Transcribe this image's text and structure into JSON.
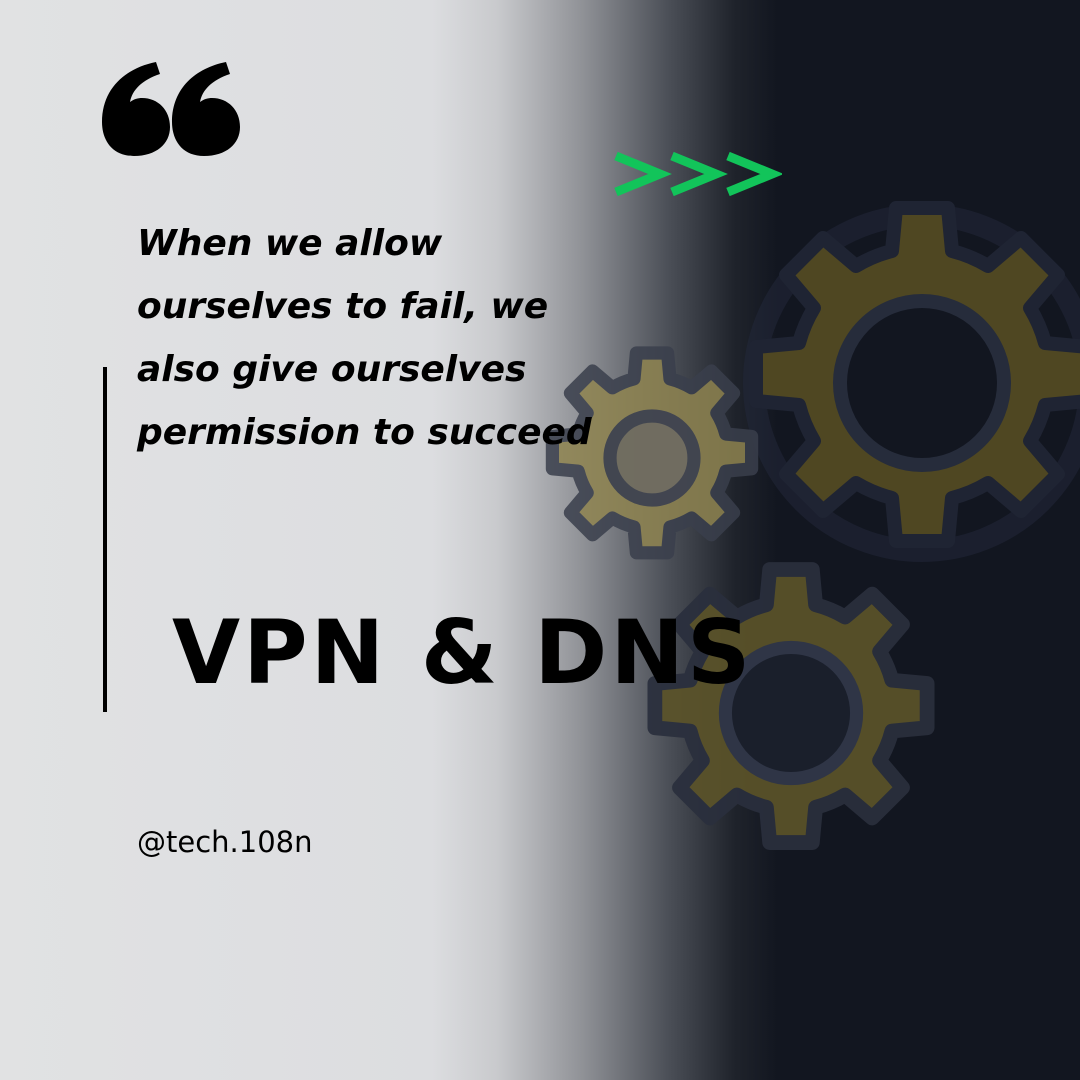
{
  "quote": {
    "text": "When we allow ourselves to fail, we also give ourselves permission to succeed",
    "mark_icon": "quote-open-icon"
  },
  "headline": "VPN & DNS",
  "handle": "@tech.108n",
  "decor": {
    "chevrons_icon": "triple-chevron-right-icon",
    "gear_icon": "gear-icon"
  },
  "colors": {
    "accent_green": "#12c45a",
    "gear_gold": "#6b6131",
    "gear_gold_light": "#8f8450",
    "gear_outline": "#2a2f3d",
    "dark_bg": "#121620",
    "light_bg": "#e1e2e3",
    "text": "#000000"
  }
}
